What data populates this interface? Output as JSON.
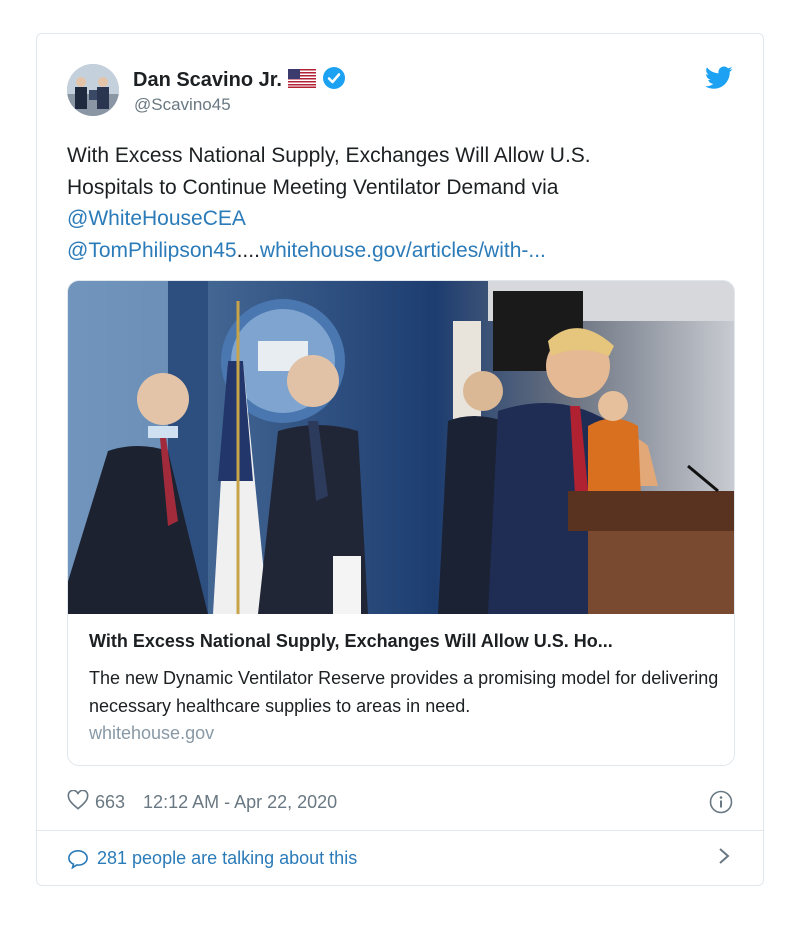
{
  "author": {
    "name": "Dan Scavino Jr.",
    "flag": "🇺🇸",
    "handle": "@Scavino45",
    "verified": true
  },
  "brand": {
    "logo_icon": "twitter-bird-icon",
    "color": "#1da1f2"
  },
  "tweet": {
    "text_line1": "With Excess National Supply, Exchanges Will Allow U.S.",
    "text_line2": "Hospitals to Continue Meeting Ventilator Demand via",
    "mention1": "@WhiteHouseCEA",
    "mention2": "@TomPhilipson45",
    "ellipsis": "....",
    "url": "whitehouse.gov/articles/with-..."
  },
  "link_card": {
    "title": "With Excess National Supply, Exchanges Will Allow U.S. Ho...",
    "description": "The new Dynamic Ventilator Reserve provides a promising model for delivering necessary healthcare supplies to areas in need.",
    "domain": "whitehouse.gov",
    "image_icon": "press-briefing-photo"
  },
  "meta": {
    "likes": "663",
    "timestamp": "12:12 AM - Apr 22, 2020",
    "heart_icon": "heart-icon",
    "info_icon": "info-icon"
  },
  "conversation": {
    "label": "281 people are talking about this",
    "icon": "comment-icon",
    "chevron": "chevron-right-icon"
  },
  "colors": {
    "link": "#2b7bb9",
    "muted": "#697882",
    "border": "#e1e8ed",
    "verified": "#1da1f2"
  }
}
